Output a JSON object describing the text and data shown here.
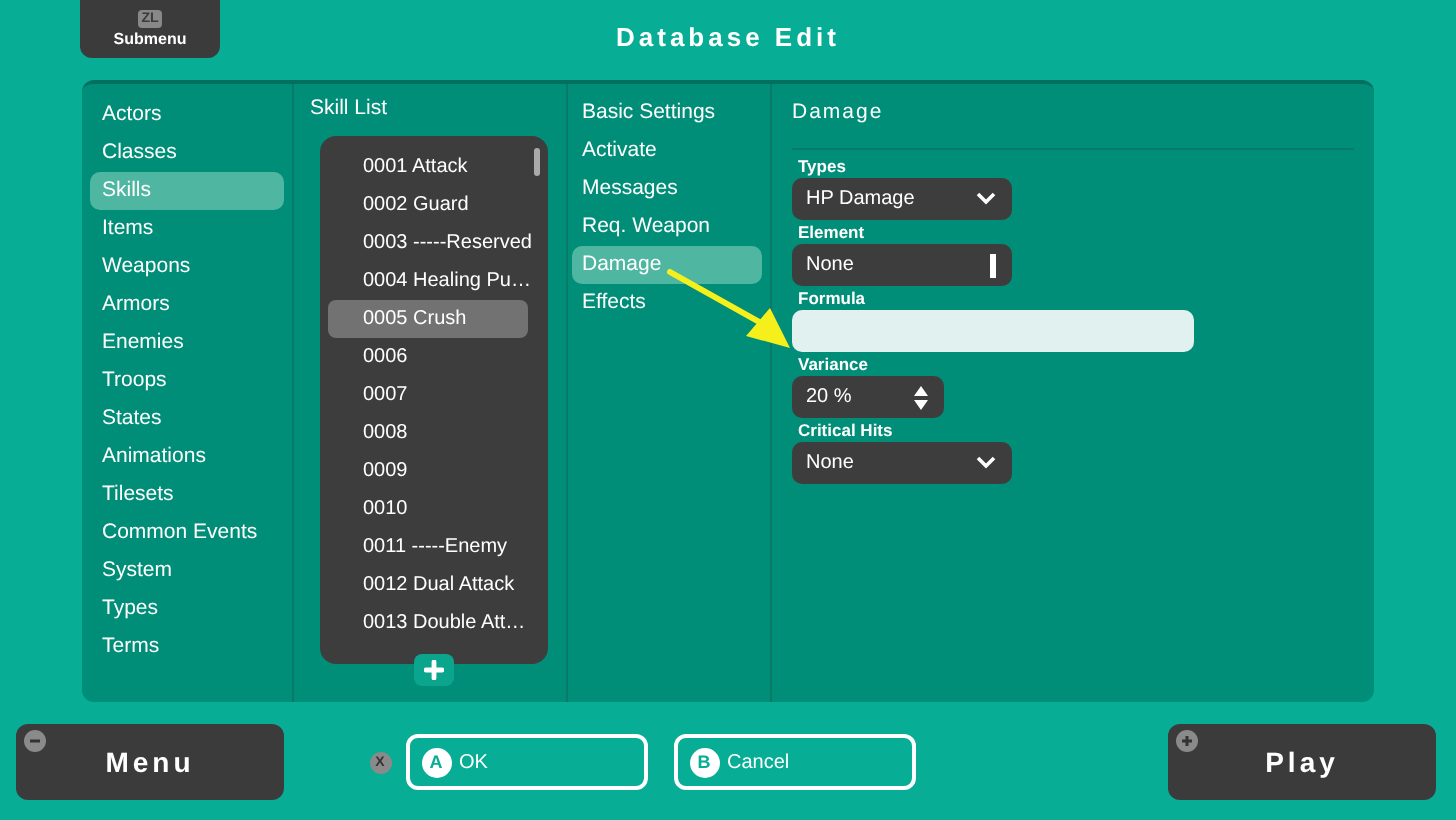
{
  "header": {
    "submenu": {
      "glyph": "ZL",
      "label": "Submenu"
    },
    "title": "Database Edit"
  },
  "categories": [
    {
      "label": "Actors",
      "selected": false
    },
    {
      "label": "Classes",
      "selected": false
    },
    {
      "label": "Skills",
      "selected": true
    },
    {
      "label": "Items",
      "selected": false
    },
    {
      "label": "Weapons",
      "selected": false
    },
    {
      "label": "Armors",
      "selected": false
    },
    {
      "label": "Enemies",
      "selected": false
    },
    {
      "label": "Troops",
      "selected": false
    },
    {
      "label": "States",
      "selected": false
    },
    {
      "label": "Animations",
      "selected": false
    },
    {
      "label": "Tilesets",
      "selected": false
    },
    {
      "label": "Common Events",
      "selected": false
    },
    {
      "label": "System",
      "selected": false
    },
    {
      "label": "Types",
      "selected": false
    },
    {
      "label": "Terms",
      "selected": false
    }
  ],
  "skill_list": {
    "title": "Skill List",
    "items": [
      {
        "label": "0001 Attack",
        "selected": false
      },
      {
        "label": "0002 Guard",
        "selected": false
      },
      {
        "label": "0003 -----Reserved",
        "selected": false
      },
      {
        "label": "0004 Healing Pu…",
        "selected": false
      },
      {
        "label": "0005 Crush",
        "selected": true
      },
      {
        "label": "0006",
        "selected": false
      },
      {
        "label": "0007",
        "selected": false
      },
      {
        "label": "0008",
        "selected": false
      },
      {
        "label": "0009",
        "selected": false
      },
      {
        "label": "0010",
        "selected": false
      },
      {
        "label": "0011 -----Enemy",
        "selected": false
      },
      {
        "label": "0012 Dual Attack",
        "selected": false
      },
      {
        "label": "0013 Double Att…",
        "selected": false
      }
    ]
  },
  "tabs": [
    {
      "label": "Basic Settings",
      "selected": false
    },
    {
      "label": "Activate",
      "selected": false
    },
    {
      "label": "Messages",
      "selected": false
    },
    {
      "label": "Req. Weapon",
      "selected": false
    },
    {
      "label": "Damage",
      "selected": true
    },
    {
      "label": "Effects",
      "selected": false
    }
  ],
  "detail": {
    "title": "Damage",
    "fields": [
      {
        "kind": "dropdown",
        "label": "Types",
        "value": "HP Damage"
      },
      {
        "kind": "picker",
        "label": "Element",
        "value": "None"
      },
      {
        "kind": "text",
        "label": "Formula"
      },
      {
        "kind": "spinner",
        "label": "Variance",
        "value": "20 %"
      },
      {
        "kind": "dropdown",
        "label": "Critical Hits",
        "value": "None"
      }
    ]
  },
  "footer": {
    "menu": {
      "label": "Menu"
    },
    "hint_glyph": "X",
    "actions": [
      {
        "glyph": "A",
        "label": "OK"
      },
      {
        "glyph": "B",
        "label": "Cancel"
      }
    ],
    "play": {
      "label": "Play"
    }
  }
}
